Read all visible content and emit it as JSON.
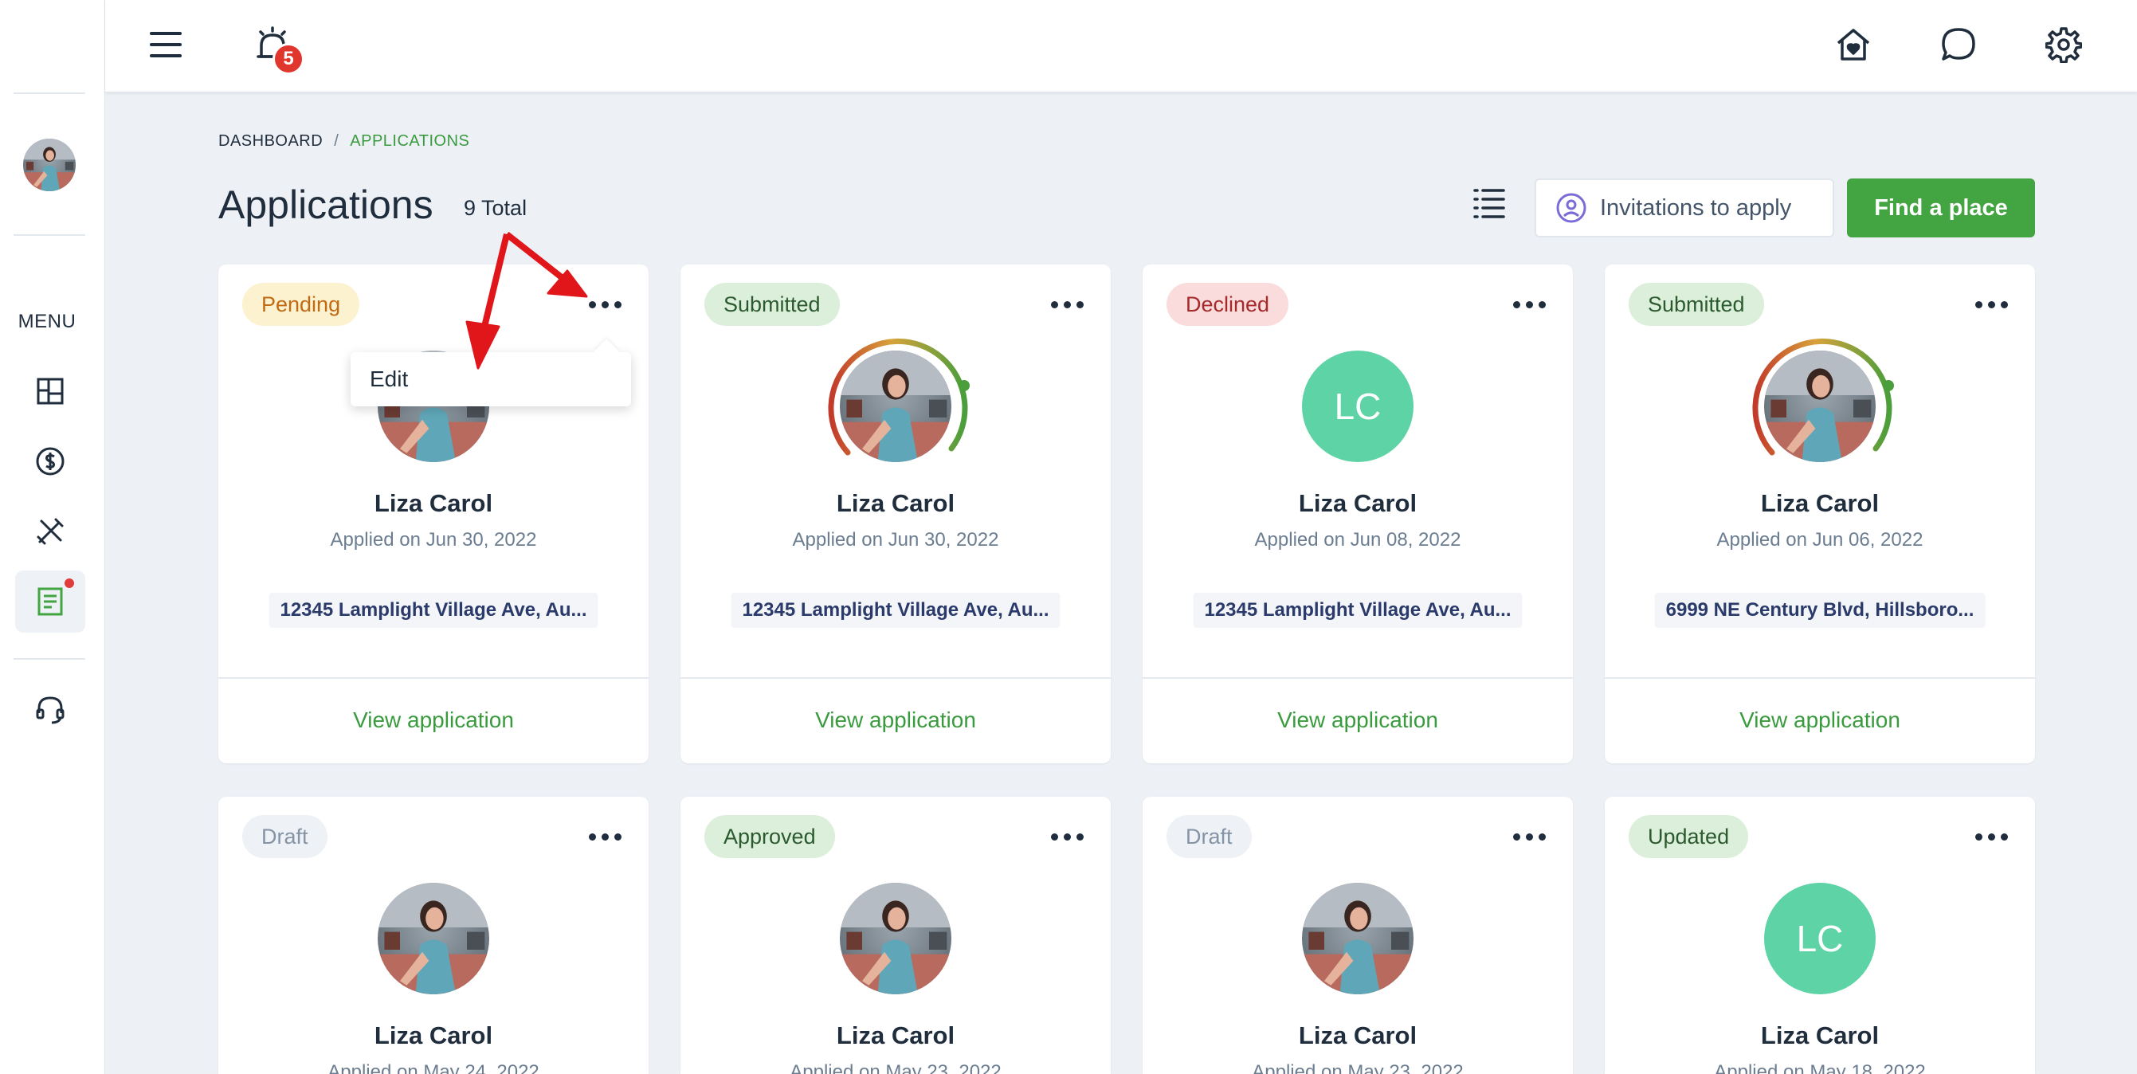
{
  "header": {
    "notification_count": "5"
  },
  "sidebar": {
    "menu_label": "MENU"
  },
  "breadcrumb": {
    "root": "DASHBOARD",
    "separator": "/",
    "current": "APPLICATIONS"
  },
  "page": {
    "title": "Applications",
    "total": "9 Total"
  },
  "actions": {
    "invitations_label": "Invitations to apply",
    "find_label": "Find a place"
  },
  "dropdown": {
    "edit_label": "Edit"
  },
  "cards": [
    {
      "status": "Pending",
      "name": "Liza Carol",
      "applied": "Applied on Jun 30, 2022",
      "address": "12345 Lamplight Village Ave, Au...",
      "link": "View application"
    },
    {
      "status": "Submitted",
      "name": "Liza Carol",
      "applied": "Applied on Jun 30, 2022",
      "address": "12345 Lamplight Village Ave, Au...",
      "link": "View application"
    },
    {
      "status": "Declined",
      "name": "Liza Carol",
      "initials": "LC",
      "applied": "Applied on Jun 08, 2022",
      "address": "12345 Lamplight Village Ave, Au...",
      "link": "View application"
    },
    {
      "status": "Submitted",
      "name": "Liza Carol",
      "applied": "Applied on Jun 06, 2022",
      "address": "6999 NE Century Blvd, Hillsboro...",
      "link": "View application"
    },
    {
      "status": "Draft",
      "name": "Liza Carol",
      "applied": "Applied on May 24, 2022"
    },
    {
      "status": "Approved",
      "name": "Liza Carol",
      "applied": "Applied on May 23, 2022"
    },
    {
      "status": "Draft",
      "name": "Liza Carol",
      "applied": "Applied on May 23, 2022"
    },
    {
      "status": "Updated",
      "name": "Liza Carol",
      "initials": "LC",
      "applied": "Applied on May 18, 2022"
    }
  ],
  "colors": {
    "accent_green": "#43a442",
    "link_green": "#3a9b3e",
    "badge_red": "#e0362d",
    "initials_teal": "#5dd3a6"
  }
}
